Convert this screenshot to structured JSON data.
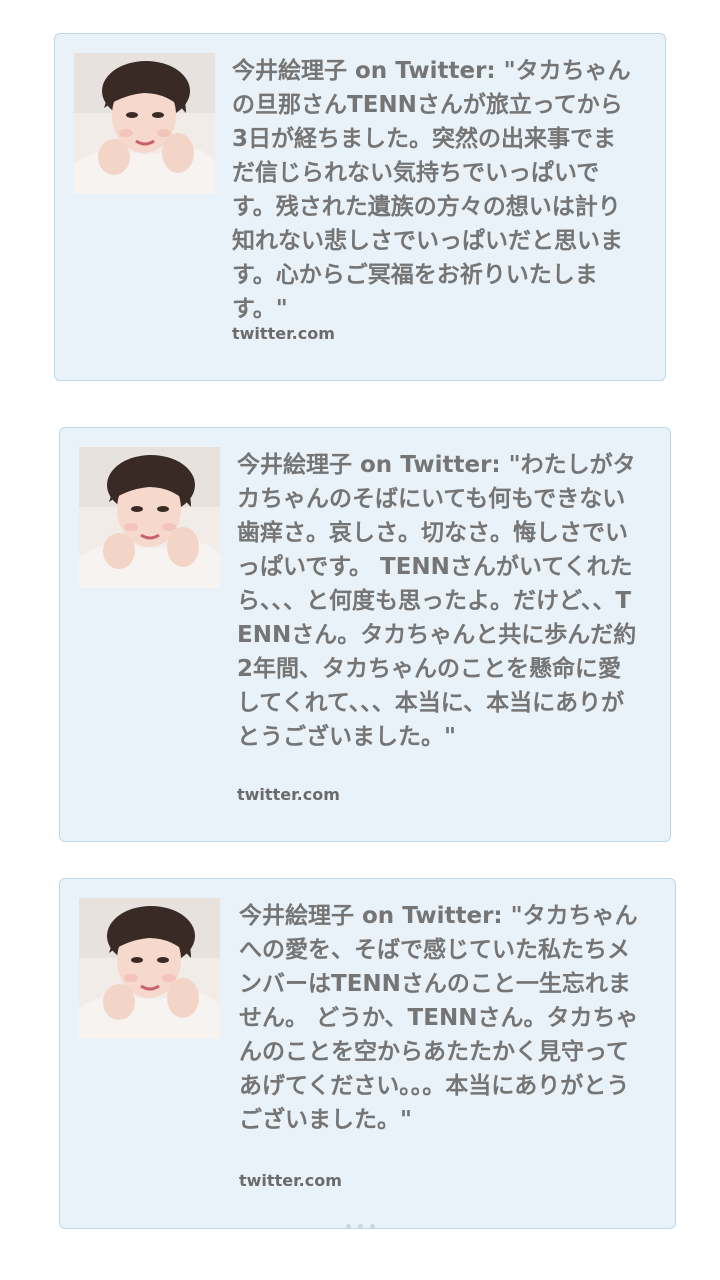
{
  "cards": [
    {
      "text": "今井絵理子 on Twitter: \"タカちゃんの旦那さんTENNさんが旅立ってから3日が経ちました。突然の出来事でまだ信じられない気持ちでいっぱいです。残された遺族の方々の想いは計り知れない悲しさでいっぱいだと思います。心からご冥福をお祈りいたします。\"",
      "domain": "twitter.com",
      "thumbnail_icon": "profile-photo-icon"
    },
    {
      "text": "今井絵理子 on Twitter: \"わたしがタカちゃんのそばにいても何もできない歯痒さ。哀しさ。切なさ。悔しさでいっぱいです。 TENNさんがいてくれたら、、、と何度も思ったよ。だけど、、TENNさん。タカちゃんと共に歩んだ約2年間、タカちゃんのことを懸命に愛してくれて、、、本当に、本当にありがとうございました。\"",
      "domain": "twitter.com",
      "thumbnail_icon": "profile-photo-icon"
    },
    {
      "text": "今井絵理子 on Twitter: \"タカちゃんへの愛を、そばで感じていた私たちメンバーはTENNさんのこと一生忘れません。 どうか、TENNさん。タカちゃんのことを空からあたたかく見守ってあげてください。。。本当にありがとうございました。\"",
      "domain": "twitter.com",
      "thumbnail_icon": "profile-photo-icon"
    }
  ],
  "colors": {
    "card_background": "#e9f2f9",
    "card_border": "#bcd8ec",
    "text": "#757575"
  }
}
